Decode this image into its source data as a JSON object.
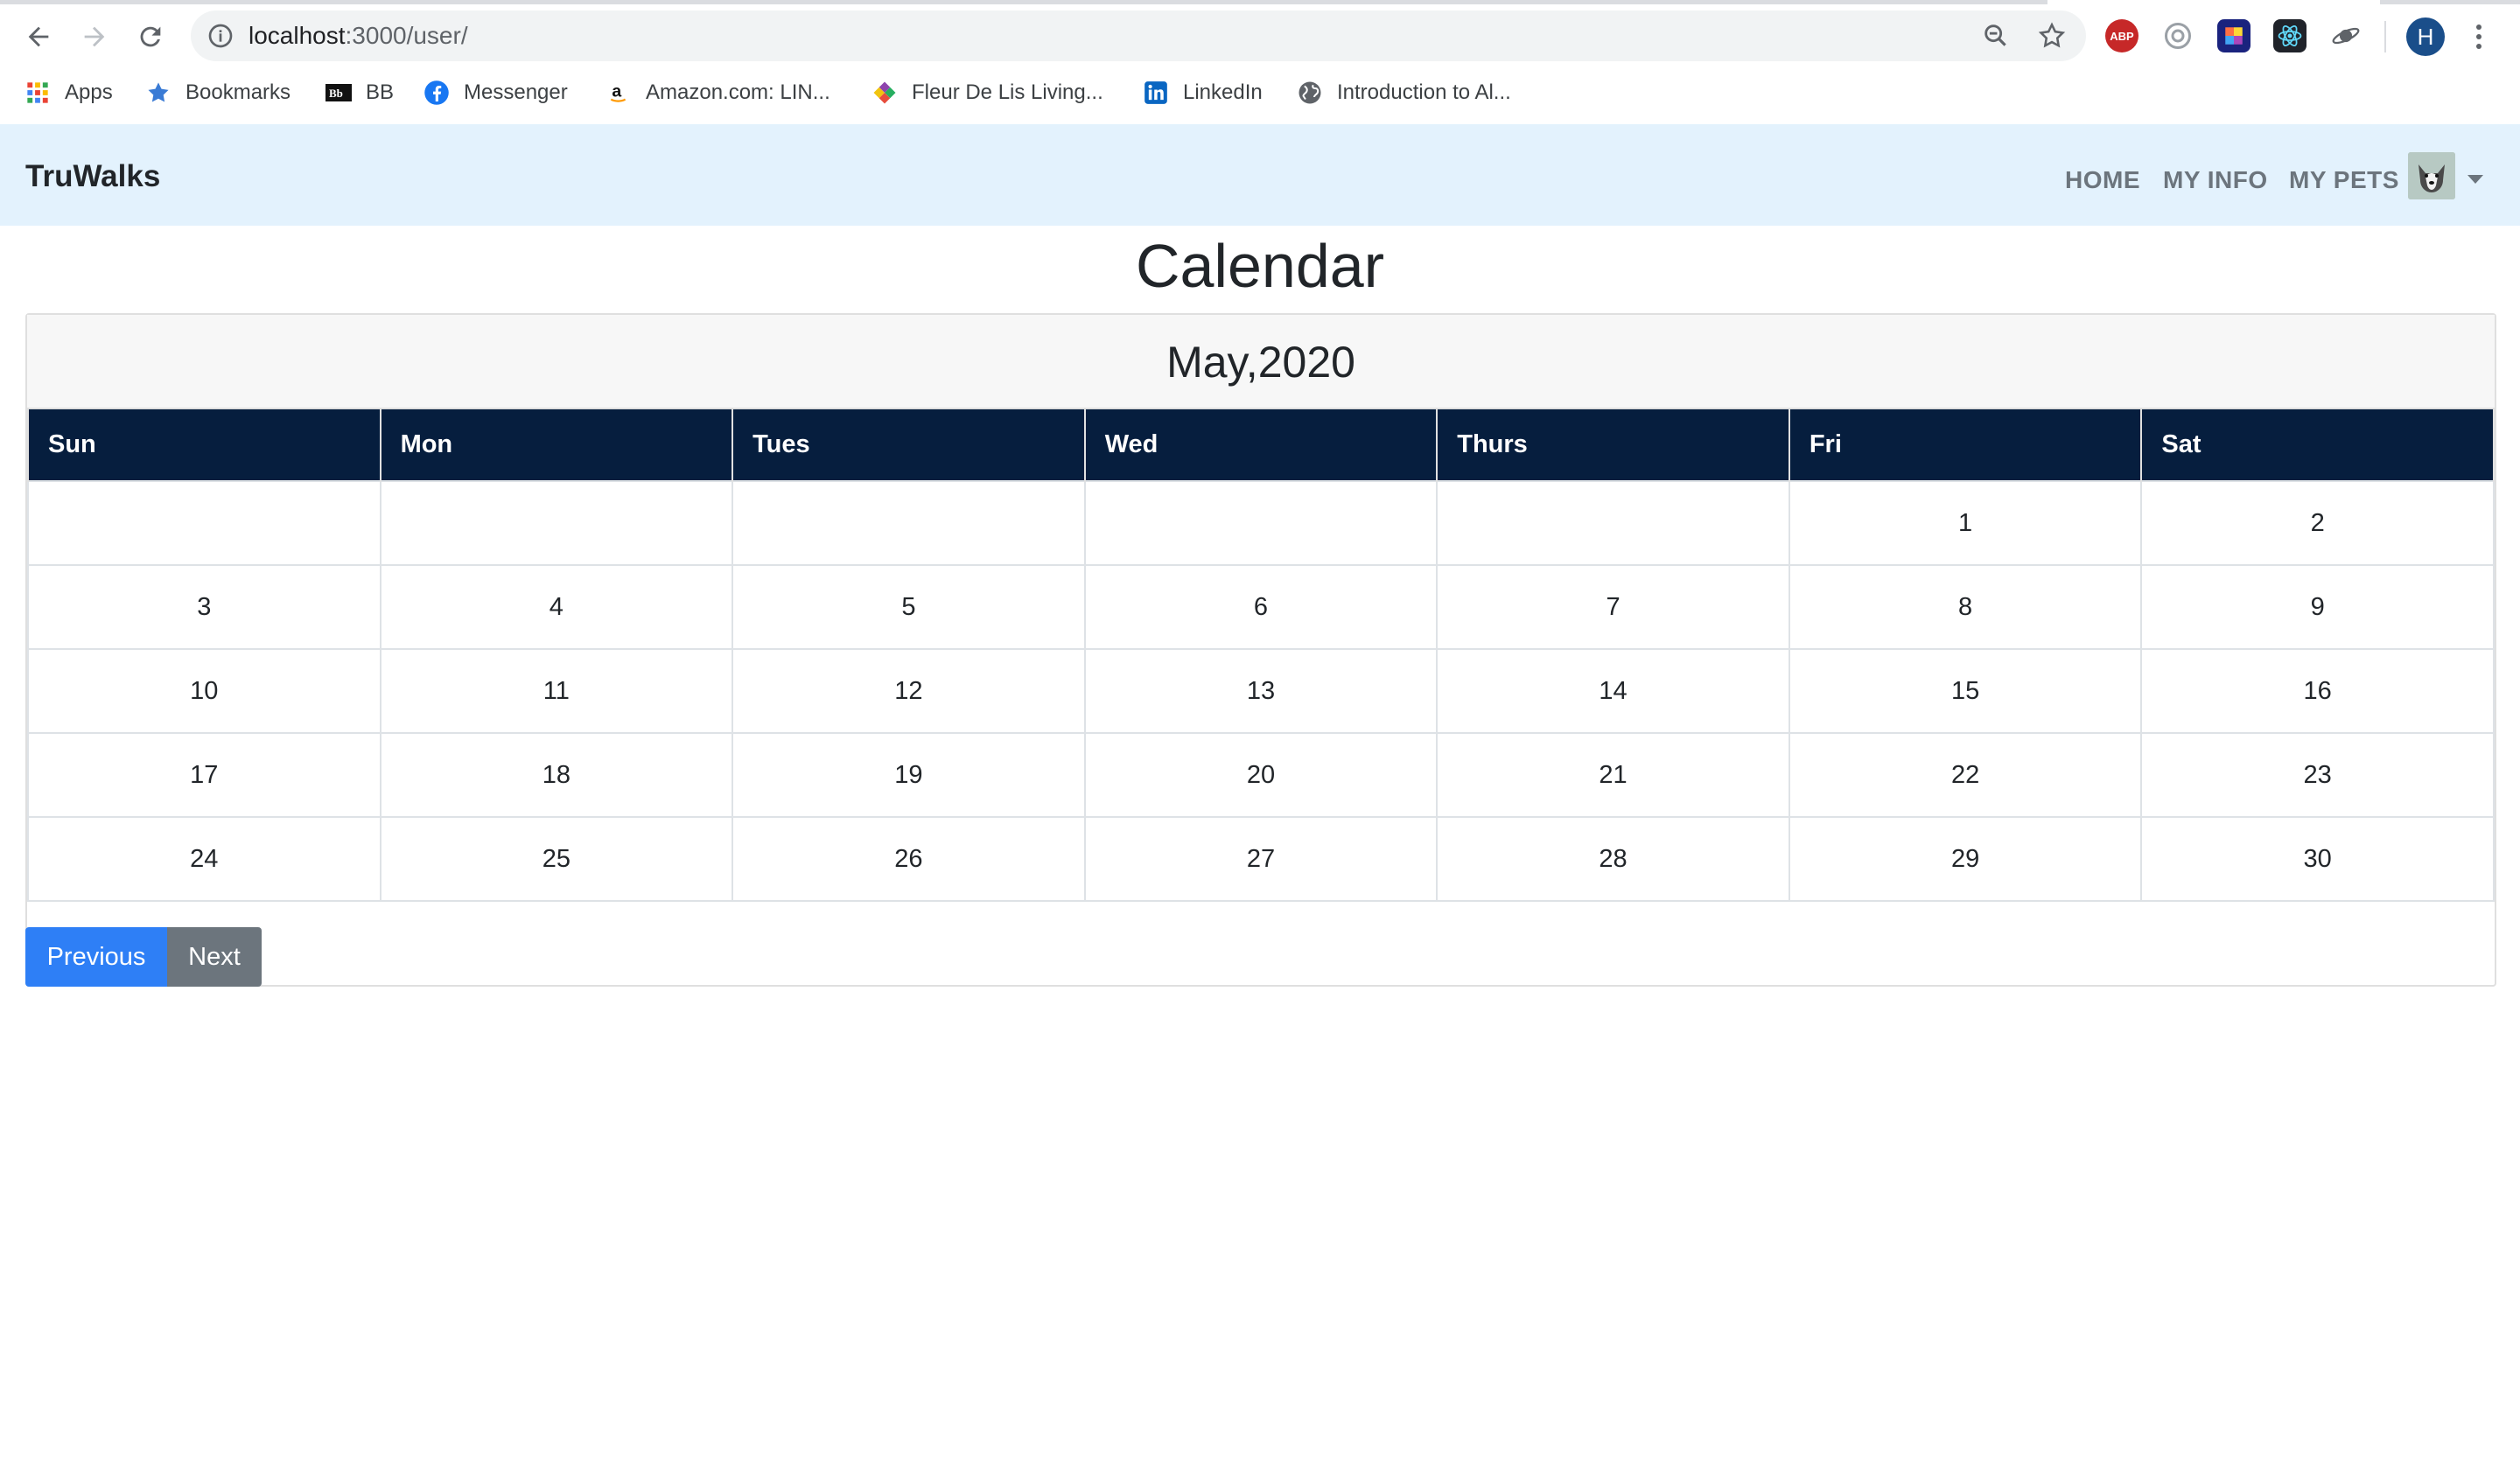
{
  "browser": {
    "url_host": "localhost",
    "url_path": ":3000/user/",
    "profile_initial": "H",
    "extensions": [
      "adblock-icon",
      "circle-ext-icon",
      "color-ext-icon",
      "react-icon",
      "saturn-icon"
    ]
  },
  "bookmarks": [
    {
      "label": "Apps",
      "icon": "apps-grid-icon"
    },
    {
      "label": "Bookmarks",
      "icon": "star-bookmark-icon"
    },
    {
      "label": "BB",
      "icon": "blackboard-icon"
    },
    {
      "label": "Messenger",
      "icon": "facebook-icon"
    },
    {
      "label": "Amazon.com: LIN...",
      "icon": "amazon-icon"
    },
    {
      "label": "Fleur De Lis Living...",
      "icon": "fleur-icon"
    },
    {
      "label": "LinkedIn",
      "icon": "linkedin-icon"
    },
    {
      "label": "Introduction to Al...",
      "icon": "globe-icon"
    }
  ],
  "navbar": {
    "brand": "TruWalks",
    "links": [
      "HOME",
      "MY INFO",
      "MY PETS"
    ]
  },
  "calendar": {
    "title": "Calendar",
    "month_label": "May,2020",
    "weekdays": [
      "Sun",
      "Mon",
      "Tues",
      "Wed",
      "Thurs",
      "Fri",
      "Sat"
    ],
    "weeks": [
      [
        "",
        "",
        "",
        "",
        "",
        "1",
        "2"
      ],
      [
        "3",
        "4",
        "5",
        "6",
        "7",
        "8",
        "9"
      ],
      [
        "10",
        "11",
        "12",
        "13",
        "14",
        "15",
        "16"
      ],
      [
        "17",
        "18",
        "19",
        "20",
        "21",
        "22",
        "23"
      ],
      [
        "24",
        "25",
        "26",
        "27",
        "28",
        "29",
        "30"
      ]
    ],
    "prev_label": "Previous",
    "next_label": "Next"
  },
  "colors": {
    "navbar_bg": "#e3f2fd",
    "table_header_bg": "#061e3e",
    "prev_button": "#2e7ff6",
    "next_button": "#6c757d"
  }
}
